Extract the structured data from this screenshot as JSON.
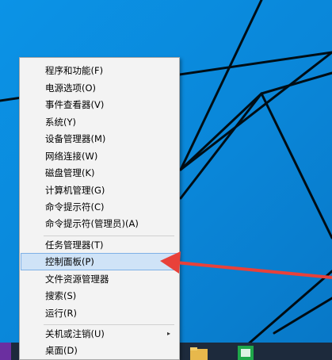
{
  "context_menu": {
    "items": [
      {
        "label": "程序和功能(F)"
      },
      {
        "label": "电源选项(O)"
      },
      {
        "label": "事件查看器(V)"
      },
      {
        "label": "系统(Y)"
      },
      {
        "label": "设备管理器(M)"
      },
      {
        "label": "网络连接(W)"
      },
      {
        "label": "磁盘管理(K)"
      },
      {
        "label": "计算机管理(G)"
      },
      {
        "label": "命令提示符(C)"
      },
      {
        "label": "命令提示符(管理员)(A)"
      },
      {
        "label": "任务管理器(T)"
      },
      {
        "label": "控制面板(P)"
      },
      {
        "label": "文件资源管理器"
      },
      {
        "label": "搜索(S)"
      },
      {
        "label": "运行(R)"
      },
      {
        "label": "关机或注销(U)"
      },
      {
        "label": "桌面(D)"
      }
    ],
    "highlighted_item": "控制面板(P)",
    "submenu_arrow": "▸"
  },
  "colors": {
    "desktop_background": "#0a8fe0",
    "menu_background": "#f3f3f3",
    "highlight_background": "#cfe3f7",
    "highlight_border": "#7fb1e6",
    "annotation_arrow": "#e8413a",
    "taskbar": "#1d2a3c"
  },
  "icons": {
    "annotation": "red-arrow-icon",
    "taskbar_left": "start-icon",
    "taskbar_folder": "folder-icon",
    "taskbar_app": "green-app-icon"
  }
}
